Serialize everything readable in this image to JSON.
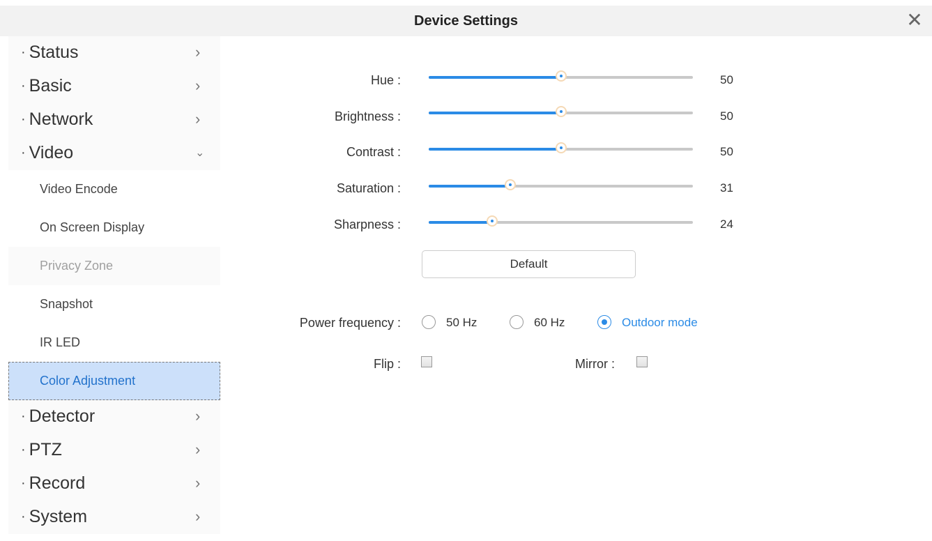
{
  "header": {
    "title": "Device Settings",
    "close_icon": "close-icon"
  },
  "sidebar": {
    "items": [
      {
        "label": "Status",
        "type": "main",
        "expanded": false
      },
      {
        "label": "Basic",
        "type": "main",
        "expanded": false
      },
      {
        "label": "Network",
        "type": "main",
        "expanded": false
      },
      {
        "label": "Video",
        "type": "main",
        "expanded": true
      },
      {
        "label": "Video Encode",
        "type": "sub"
      },
      {
        "label": "On Screen Display",
        "type": "sub"
      },
      {
        "label": "Privacy Zone",
        "type": "sub",
        "disabled": true
      },
      {
        "label": "Snapshot",
        "type": "sub"
      },
      {
        "label": "IR LED",
        "type": "sub"
      },
      {
        "label": "Color Adjustment",
        "type": "sub",
        "active": true
      },
      {
        "label": "Detector",
        "type": "main",
        "expanded": false
      },
      {
        "label": "PTZ",
        "type": "main",
        "expanded": false
      },
      {
        "label": "Record",
        "type": "main",
        "expanded": false
      },
      {
        "label": "System",
        "type": "main",
        "expanded": false
      }
    ],
    "bullet": "·",
    "chevron_right": "›",
    "chevron_down": "⌄"
  },
  "sliders": [
    {
      "label": "Hue :",
      "value": "50",
      "percent": 50
    },
    {
      "label": "Brightness :",
      "value": "50",
      "percent": 50
    },
    {
      "label": "Contrast :",
      "value": "50",
      "percent": 50
    },
    {
      "label": "Saturation :",
      "value": "31",
      "percent": 31
    },
    {
      "label": "Sharpness :",
      "value": "24",
      "percent": 24
    }
  ],
  "default_button": "Default",
  "power_frequency": {
    "label": "Power frequency :",
    "options": [
      {
        "label": "50 Hz",
        "checked": false
      },
      {
        "label": "60 Hz",
        "checked": false
      },
      {
        "label": "Outdoor mode",
        "checked": true
      }
    ]
  },
  "flip": {
    "label": "Flip :",
    "checked": false
  },
  "mirror": {
    "label": "Mirror :",
    "checked": false
  },
  "colors": {
    "accent": "#2b8be6",
    "active_bg": "#cce0fa"
  }
}
